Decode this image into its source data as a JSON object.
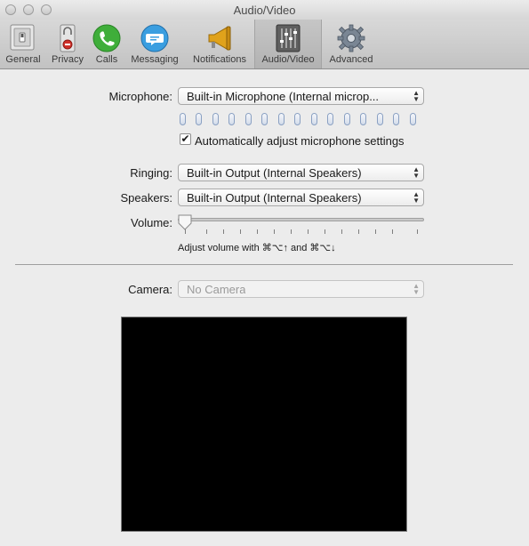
{
  "window": {
    "title": "Audio/Video"
  },
  "toolbar": {
    "items": [
      {
        "label": "General",
        "icon": "general-switch-icon"
      },
      {
        "label": "Privacy",
        "icon": "privacy-lock-icon"
      },
      {
        "label": "Calls",
        "icon": "phone-icon"
      },
      {
        "label": "Messaging",
        "icon": "chat-bubble-icon"
      },
      {
        "label": "Notifications",
        "icon": "megaphone-icon"
      },
      {
        "label": "Audio/Video",
        "icon": "mixer-sliders-icon",
        "selected": true
      },
      {
        "label": "Advanced",
        "icon": "gear-icon"
      }
    ]
  },
  "microphone": {
    "label": "Microphone:",
    "value": "Built-in Microphone (Internal microp...",
    "level_fraction": 0,
    "auto_adjust": {
      "label": "Automatically adjust microphone settings",
      "checked": true
    }
  },
  "ringing": {
    "label": "Ringing:",
    "value": "Built-in Output (Internal Speakers)"
  },
  "speakers": {
    "label": "Speakers:",
    "value": "Built-in Output (Internal Speakers)"
  },
  "volume": {
    "label": "Volume:",
    "level_fraction": 0,
    "hint": "Adjust volume with ⌘⌥↑ and ⌘⌥↓"
  },
  "camera": {
    "label": "Camera:",
    "value": "No Camera",
    "enabled": false
  },
  "colors": {
    "calls_green": "#3fae3a",
    "messaging_blue": "#3a9ee0",
    "notifications_amber": "#e0a21b",
    "preview_bg": "#000000"
  }
}
